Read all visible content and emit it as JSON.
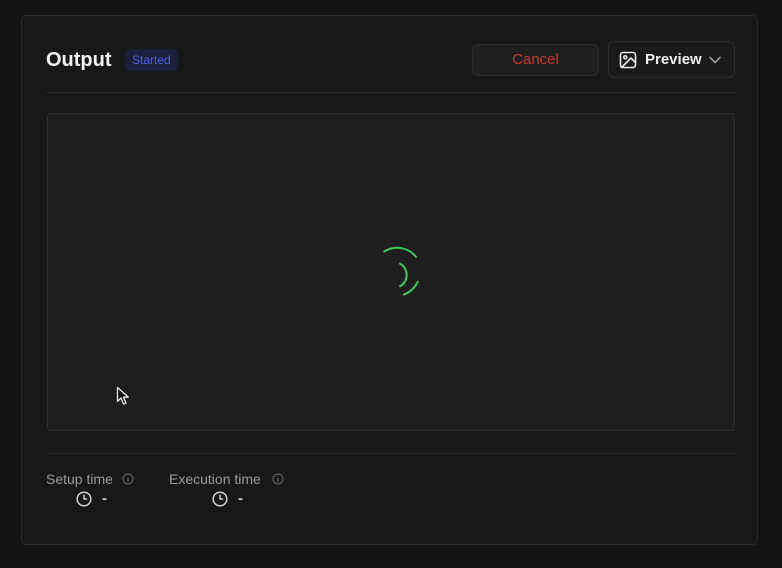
{
  "header": {
    "title": "Output",
    "status_badge": "Started",
    "cancel_label": "Cancel",
    "preview_label": "Preview"
  },
  "metrics": [
    {
      "label": "Setup time",
      "value": "-"
    },
    {
      "label": "Execution time",
      "value": "-"
    }
  ],
  "icons": {
    "preview": "image-icon",
    "dropdown": "chevron-down-icon",
    "info": "info-icon",
    "clock": "clock-icon",
    "loading": "spinner-icon",
    "cursor": "mouse-cursor-icon"
  },
  "colors": {
    "background": "#141414",
    "card": "#181818",
    "badge_bg": "#1b1f3d",
    "badge_text": "#4a63e6",
    "cancel_text": "#c9372c",
    "spinner": "#3fc95a"
  }
}
